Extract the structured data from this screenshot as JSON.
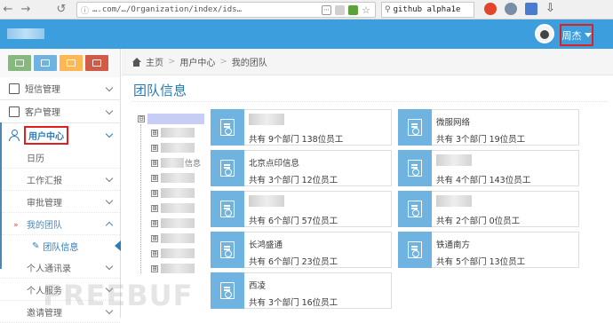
{
  "browser": {
    "url": "….com/…/Organization/index/ids…",
    "search_text": "github alpha1e"
  },
  "header": {
    "user_name": "周杰"
  },
  "sidebar": {
    "items": [
      {
        "label": "短信管理",
        "icon": "envelope-icon"
      },
      {
        "label": "客户管理",
        "icon": "contact-card-icon"
      },
      {
        "label": "用户中心",
        "icon": "user-icon"
      }
    ],
    "sub_items": [
      {
        "label": "日历"
      },
      {
        "label": "工作汇报"
      },
      {
        "label": "审批管理"
      },
      {
        "label": "我的团队"
      }
    ],
    "active_leaf": "团队信息",
    "more_items": [
      {
        "label": "个人通讯录"
      },
      {
        "label": "个人服务"
      },
      {
        "label": "邀请管理"
      }
    ]
  },
  "breadcrumb": {
    "items": [
      "主页",
      "用户中心",
      "我的团队"
    ],
    "separator": ">"
  },
  "page": {
    "title": "团队信息"
  },
  "tree": {
    "expanded_symbol": "⊟",
    "collapsed_symbol": "⊞",
    "partial_label": "信息"
  },
  "cards": [
    {
      "name": "",
      "stat": "共有 9个部门 138位员工"
    },
    {
      "name": "微服网络",
      "stat": "共有 3个部门 19位员工"
    },
    {
      "name": "北京点印信息",
      "stat": "共有 3个部门 12位员工"
    },
    {
      "name": "",
      "stat": "共有 4个部门 143位员工"
    },
    {
      "name": "",
      "stat": "共有 6个部门 57位员工"
    },
    {
      "name": "",
      "stat": "共有 2个部门 0位员工"
    },
    {
      "name": "长鸿盛通",
      "stat": "共有 6个部门 23位员工"
    },
    {
      "name": "铁通南方",
      "stat": "共有 5个部门 13位员工"
    },
    {
      "name": "西凌",
      "stat": "共有 3个部门 16位员工"
    }
  ],
  "watermark": "FREEBUF",
  "colors": {
    "header_bg": "#3c9edc",
    "accent": "#2679b5",
    "card_icon_bg": "#6fb3e0",
    "highlight": "#e02020"
  }
}
